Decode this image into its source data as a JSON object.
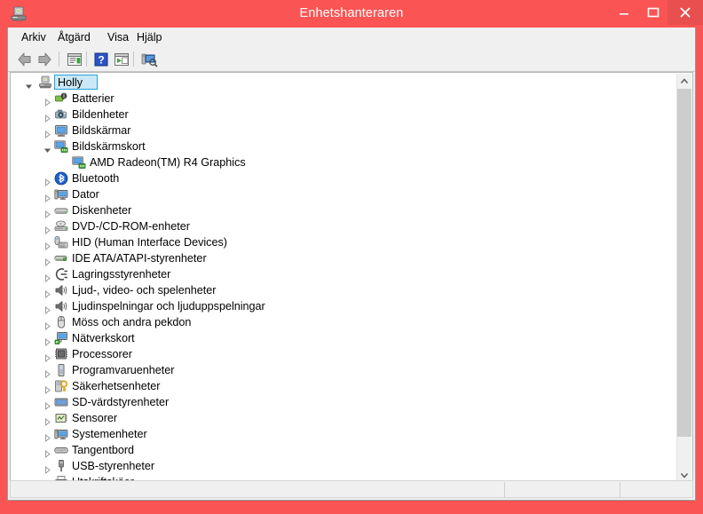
{
  "window": {
    "title": "Enhetshanteraren",
    "app_icon": "device-manager-icon",
    "minimize_label": "–",
    "maximize_label": "□",
    "close_label": "×",
    "frame_color": "#fb5454",
    "close_hover_color": "#e84f4f"
  },
  "menubar": {
    "items": [
      {
        "label": "Arkiv"
      },
      {
        "label": "Åtgärd"
      },
      {
        "label": "Visa"
      },
      {
        "label": "Hjälp"
      }
    ]
  },
  "toolbar": {
    "buttons": [
      {
        "name": "back-button",
        "icon": "arrow-left-icon"
      },
      {
        "name": "forward-button",
        "icon": "arrow-right-icon"
      },
      {
        "name": "properties-button",
        "icon": "properties-window-icon"
      },
      {
        "name": "help-button",
        "icon": "question-mark-icon"
      },
      {
        "name": "show-hidden-button",
        "icon": "window-play-icon"
      },
      {
        "name": "scan-hardware-changes-button",
        "icon": "scan-monitor-icon"
      }
    ]
  },
  "tree": {
    "root": {
      "label": "Holly",
      "icon": "computer-icon",
      "expanded": true,
      "selected": true
    },
    "nodes": [
      {
        "label": "Batterier",
        "icon": "battery-icon",
        "expanded": false,
        "depth": 1
      },
      {
        "label": "Bildenheter",
        "icon": "camera-icon",
        "expanded": false,
        "depth": 1
      },
      {
        "label": "Bildskärmar",
        "icon": "monitor-icon",
        "expanded": false,
        "depth": 1
      },
      {
        "label": "Bildskärmskort",
        "icon": "display-adapter-icon",
        "expanded": true,
        "depth": 1
      },
      {
        "label": "AMD Radeon(TM) R4 Graphics",
        "icon": "display-adapter-icon",
        "expanded": null,
        "depth": 2
      },
      {
        "label": "Bluetooth",
        "icon": "bluetooth-icon",
        "expanded": false,
        "depth": 1
      },
      {
        "label": "Dator",
        "icon": "computer-device-icon",
        "expanded": false,
        "depth": 1
      },
      {
        "label": "Diskenheter",
        "icon": "disk-drive-icon",
        "expanded": false,
        "depth": 1
      },
      {
        "label": "DVD-/CD-ROM-enheter",
        "icon": "optical-drive-icon",
        "expanded": false,
        "depth": 1
      },
      {
        "label": "HID (Human Interface Devices)",
        "icon": "hid-icon",
        "expanded": false,
        "depth": 1
      },
      {
        "label": "IDE ATA/ATAPI-styrenheter",
        "icon": "ide-controller-icon",
        "expanded": false,
        "depth": 1
      },
      {
        "label": "Lagringsstyrenheter",
        "icon": "storage-controller-icon",
        "expanded": false,
        "depth": 1
      },
      {
        "label": "Ljud-, video- och spelenheter",
        "icon": "speaker-icon",
        "expanded": false,
        "depth": 1
      },
      {
        "label": "Ljudinspelningar och ljuduppspelningar",
        "icon": "speaker-icon",
        "expanded": false,
        "depth": 1
      },
      {
        "label": "Möss och andra pekdon",
        "icon": "mouse-icon",
        "expanded": false,
        "depth": 1
      },
      {
        "label": "Nätverkskort",
        "icon": "network-adapter-icon",
        "expanded": false,
        "depth": 1
      },
      {
        "label": "Processorer",
        "icon": "processor-icon",
        "expanded": false,
        "depth": 1
      },
      {
        "label": "Programvaruenheter",
        "icon": "software-device-icon",
        "expanded": false,
        "depth": 1
      },
      {
        "label": "Säkerhetsenheter",
        "icon": "security-key-icon",
        "expanded": false,
        "depth": 1
      },
      {
        "label": "SD-värdstyrenheter",
        "icon": "sd-host-icon",
        "expanded": false,
        "depth": 1
      },
      {
        "label": "Sensorer",
        "icon": "sensor-icon",
        "expanded": false,
        "depth": 1
      },
      {
        "label": "Systemenheter",
        "icon": "system-device-icon",
        "expanded": false,
        "depth": 1
      },
      {
        "label": "Tangentbord",
        "icon": "keyboard-icon",
        "expanded": false,
        "depth": 1
      },
      {
        "label": "USB-styrenheter",
        "icon": "usb-icon",
        "expanded": false,
        "depth": 1
      },
      {
        "label": "Utskriftsköer",
        "icon": "printer-icon",
        "expanded": false,
        "depth": 1
      }
    ]
  },
  "scrollbar": {
    "up_arrow": "chevron-up-icon",
    "down_arrow": "chevron-down-icon"
  },
  "statusbar": {
    "cells": [
      "",
      "",
      ""
    ]
  }
}
